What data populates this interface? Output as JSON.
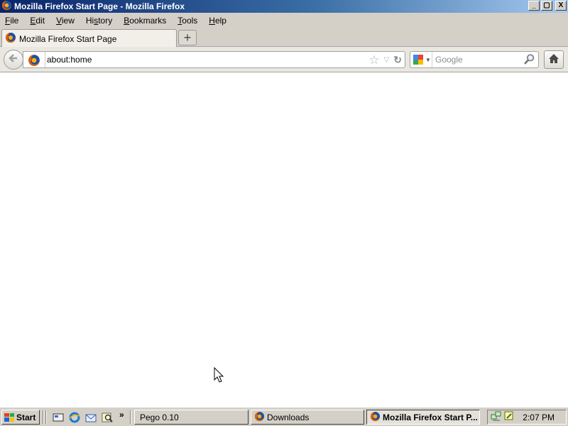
{
  "window": {
    "title": "Mozilla Firefox Start Page - Mozilla Firefox",
    "controls": [
      "_",
      "▢",
      "X"
    ]
  },
  "menubar": {
    "items": [
      {
        "accel": "F",
        "rest": "ile"
      },
      {
        "accel": "E",
        "rest": "dit"
      },
      {
        "accel": "V",
        "rest": "iew"
      },
      {
        "accel": "",
        "pre": "Hi",
        "accel_mid": "s",
        "rest": "tory"
      },
      {
        "accel": "B",
        "rest": "ookmarks"
      },
      {
        "accel": "T",
        "rest": "ools"
      },
      {
        "accel": "H",
        "rest": "elp"
      }
    ]
  },
  "tabs": {
    "active_label": "Mozilla Firefox Start Page",
    "new_tab_icon": "plus-icon"
  },
  "navbar": {
    "url": "about:home",
    "search_placeholder": "Google"
  },
  "taskbar": {
    "start_label": "Start",
    "quick_launch_icons": [
      "show-desktop-icon",
      "internet-explorer-icon",
      "outlook-express-icon",
      "search-icon"
    ],
    "chevron": "»",
    "tasks": [
      {
        "label": "Pego 0.10",
        "active": false
      },
      {
        "label": "Downloads",
        "active": false
      },
      {
        "label": "Mozilla Firefox Start P...",
        "active": true
      }
    ],
    "clock": "2:07 PM"
  },
  "colors": {
    "titlebar_start": "#0a246a",
    "titlebar_end": "#a6caf0",
    "chrome": "#d4d0c8"
  }
}
